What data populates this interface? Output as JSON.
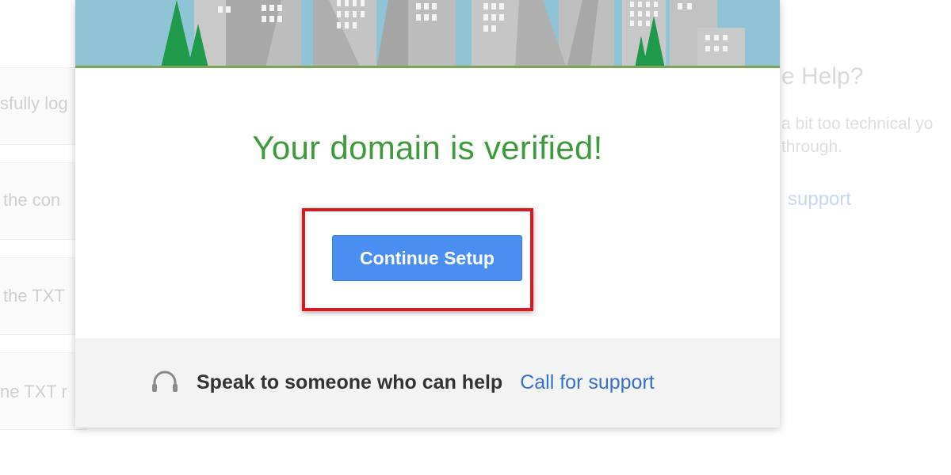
{
  "background": {
    "left_fragments": [
      "sfully log",
      "the con",
      "the TXT",
      "ne TXT r"
    ],
    "right_panel": {
      "title": "e Help?",
      "body_lines": [
        "a bit too technical yo",
        "through."
      ],
      "link": "support"
    }
  },
  "modal": {
    "title": "Your domain is verified!",
    "continue_button": "Continue Setup",
    "footer": {
      "text": "Speak to someone who can help",
      "link": "Call for support"
    }
  },
  "colors": {
    "title": "#3e9a3c",
    "button": "#4a8ef2",
    "highlight": "#e1161c",
    "link": "#3770c8",
    "banner_sky": "#8ec4d6",
    "tree": "#1e9a4a"
  },
  "icons": {
    "footer": "headset-icon"
  }
}
